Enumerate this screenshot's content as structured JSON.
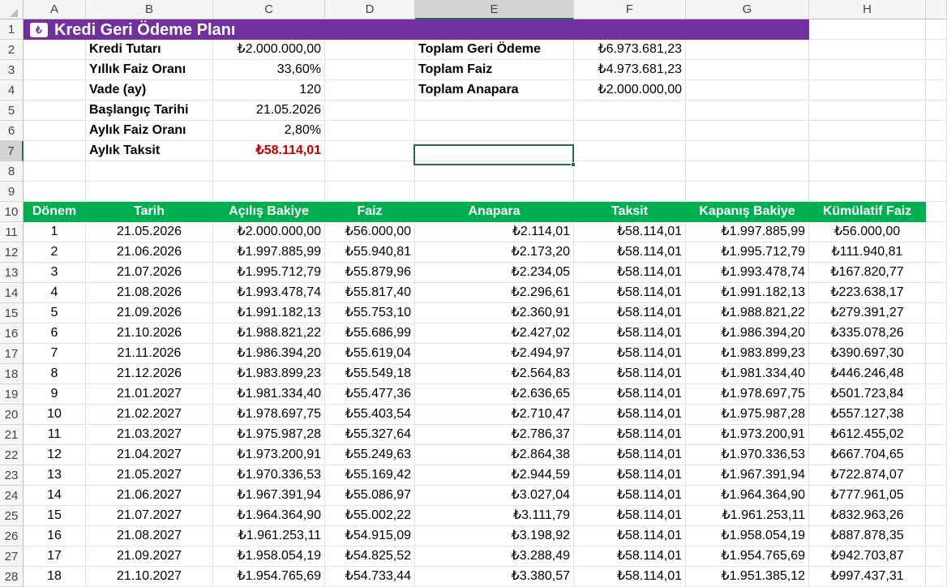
{
  "columns": [
    "A",
    "B",
    "C",
    "D",
    "E",
    "F",
    "G",
    "H"
  ],
  "selected_column": "E",
  "selected_row": 7,
  "row_numbers": [
    1,
    2,
    3,
    4,
    5,
    6,
    7,
    8,
    9,
    10,
    11,
    12,
    13,
    14,
    15,
    16,
    17,
    18,
    19,
    20,
    21,
    22,
    23,
    24,
    25,
    26,
    27,
    28
  ],
  "title": "Kredi Geri Ödeme Planı",
  "title_icon": "calculator-icon",
  "inputs": [
    {
      "label": "Kredi Tutarı",
      "value": "₺2.000.000,00"
    },
    {
      "label": "Yıllık Faiz Oranı",
      "value": "33,60%"
    },
    {
      "label": "Vade (ay)",
      "value": "120"
    },
    {
      "label": "Başlangıç Tarihi",
      "value": "21.05.2026"
    },
    {
      "label": "Aylık Faiz Oranı",
      "value": "2,80%"
    },
    {
      "label": "Aylık Taksit",
      "value": "₺58.114,01"
    }
  ],
  "summary": [
    {
      "label": "Toplam Geri Ödeme",
      "value": "₺6.973.681,23"
    },
    {
      "label": "Toplam Faiz",
      "value": "₺4.973.681,23"
    },
    {
      "label": "Toplam Anapara",
      "value": "₺2.000.000,00"
    }
  ],
  "table_headers": [
    "Dönem",
    "Tarih",
    "Açılış Bakiye",
    "Faiz",
    "Anapara",
    "Taksit",
    "Kapanış Bakiye",
    "Kümülatif Faiz"
  ],
  "table_rows": [
    [
      "1",
      "21.05.2026",
      "₺2.000.000,00",
      "₺56.000,00",
      "₺2.114,01",
      "₺58.114,01",
      "₺1.997.885,99",
      "₺56.000,00"
    ],
    [
      "2",
      "21.06.2026",
      "₺1.997.885,99",
      "₺55.940,81",
      "₺2.173,20",
      "₺58.114,01",
      "₺1.995.712,79",
      "₺111.940,81"
    ],
    [
      "3",
      "21.07.2026",
      "₺1.995.712,79",
      "₺55.879,96",
      "₺2.234,05",
      "₺58.114,01",
      "₺1.993.478,74",
      "₺167.820,77"
    ],
    [
      "4",
      "21.08.2026",
      "₺1.993.478,74",
      "₺55.817,40",
      "₺2.296,61",
      "₺58.114,01",
      "₺1.991.182,13",
      "₺223.638,17"
    ],
    [
      "5",
      "21.09.2026",
      "₺1.991.182,13",
      "₺55.753,10",
      "₺2.360,91",
      "₺58.114,01",
      "₺1.988.821,22",
      "₺279.391,27"
    ],
    [
      "6",
      "21.10.2026",
      "₺1.988.821,22",
      "₺55.686,99",
      "₺2.427,02",
      "₺58.114,01",
      "₺1.986.394,20",
      "₺335.078,26"
    ],
    [
      "7",
      "21.11.2026",
      "₺1.986.394,20",
      "₺55.619,04",
      "₺2.494,97",
      "₺58.114,01",
      "₺1.983.899,23",
      "₺390.697,30"
    ],
    [
      "8",
      "21.12.2026",
      "₺1.983.899,23",
      "₺55.549,18",
      "₺2.564,83",
      "₺58.114,01",
      "₺1.981.334,40",
      "₺446.246,48"
    ],
    [
      "9",
      "21.01.2027",
      "₺1.981.334,40",
      "₺55.477,36",
      "₺2.636,65",
      "₺58.114,01",
      "₺1.978.697,75",
      "₺501.723,84"
    ],
    [
      "10",
      "21.02.2027",
      "₺1.978.697,75",
      "₺55.403,54",
      "₺2.710,47",
      "₺58.114,01",
      "₺1.975.987,28",
      "₺557.127,38"
    ],
    [
      "11",
      "21.03.2027",
      "₺1.975.987,28",
      "₺55.327,64",
      "₺2.786,37",
      "₺58.114,01",
      "₺1.973.200,91",
      "₺612.455,02"
    ],
    [
      "12",
      "21.04.2027",
      "₺1.973.200,91",
      "₺55.249,63",
      "₺2.864,38",
      "₺58.114,01",
      "₺1.970.336,53",
      "₺667.704,65"
    ],
    [
      "13",
      "21.05.2027",
      "₺1.970.336,53",
      "₺55.169,42",
      "₺2.944,59",
      "₺58.114,01",
      "₺1.967.391,94",
      "₺722.874,07"
    ],
    [
      "14",
      "21.06.2027",
      "₺1.967.391,94",
      "₺55.086,97",
      "₺3.027,04",
      "₺58.114,01",
      "₺1.964.364,90",
      "₺777.961,05"
    ],
    [
      "15",
      "21.07.2027",
      "₺1.964.364,90",
      "₺55.002,22",
      "₺3.111,79",
      "₺58.114,01",
      "₺1.961.253,11",
      "₺832.963,26"
    ],
    [
      "16",
      "21.08.2027",
      "₺1.961.253,11",
      "₺54.915,09",
      "₺3.198,92",
      "₺58.114,01",
      "₺1.958.054,19",
      "₺887.878,35"
    ],
    [
      "17",
      "21.09.2027",
      "₺1.958.054,19",
      "₺54.825,52",
      "₺3.288,49",
      "₺58.114,01",
      "₺1.954.765,69",
      "₺942.703,87"
    ],
    [
      "18",
      "21.10.2027",
      "₺1.954.765,69",
      "₺54.733,44",
      "₺3.380,57",
      "₺58.114,01",
      "₺1.951.385,12",
      "₺997.437,31"
    ]
  ],
  "colors": {
    "title_bg": "#7030a0",
    "header_bg": "#00b050",
    "accent_red": "#c00000",
    "selection": "#1e7145"
  }
}
